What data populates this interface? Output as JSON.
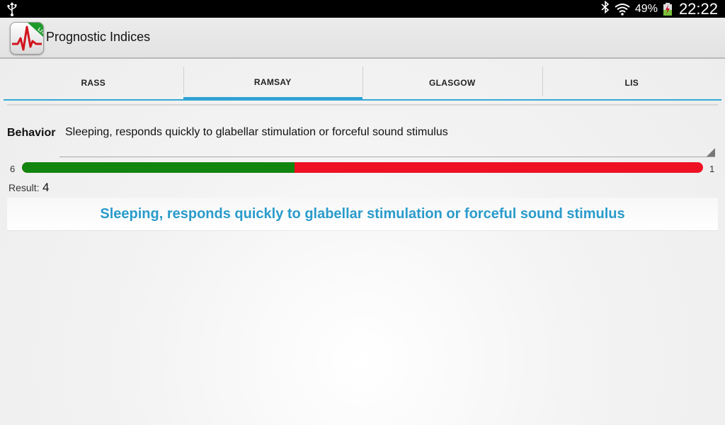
{
  "status_bar": {
    "usb_icon": "usb-icon",
    "bluetooth_icon": "bluetooth-icon",
    "wifi_icon": "wifi-icon",
    "battery_percent": "49%",
    "battery_icon": "battery-charging-icon",
    "time": "22:22"
  },
  "action_bar": {
    "app_icon": "heartbeat-monitor-lite-icon",
    "title": "Prognostic Indices"
  },
  "tabs": [
    {
      "label": "RASS",
      "active": false
    },
    {
      "label": "RAMSAY",
      "active": true
    },
    {
      "label": "GLASGOW",
      "active": false
    },
    {
      "label": "LIS",
      "active": false
    }
  ],
  "behavior": {
    "label": "Behavior",
    "selected": "Sleeping, responds quickly to glabellar stimulation or forceful sound stimulus"
  },
  "scale": {
    "min_label": "6",
    "max_label": "1",
    "level": 0.4,
    "low_color": "#12850f",
    "high_color": "#ee1124"
  },
  "result": {
    "label": "Result:",
    "value": "4",
    "description": "Sleeping, responds quickly to glabellar stimulation or forceful sound stimulus",
    "description_color": "#2a9bcb"
  },
  "accent_color": "#2fa3d4"
}
